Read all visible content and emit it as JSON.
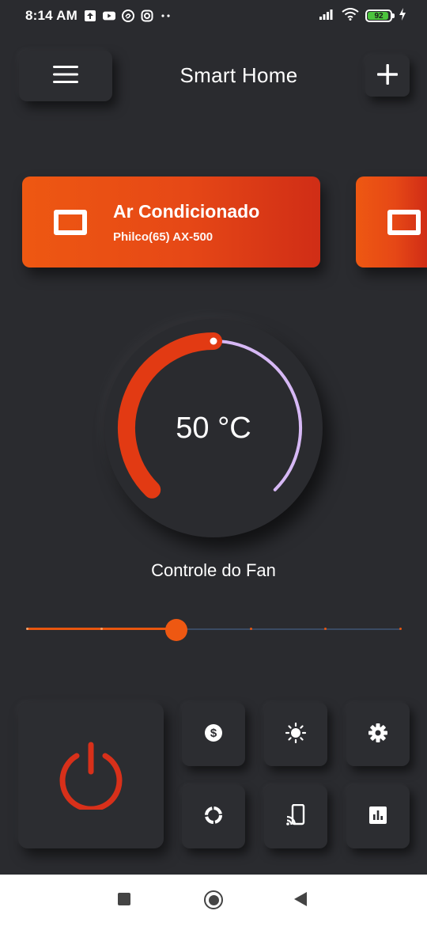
{
  "status_bar": {
    "time": "8:14 AM",
    "icons_left": [
      "upload-icon",
      "youtube-icon",
      "shazam-icon",
      "instagram-icon",
      "more-dots-icon"
    ],
    "icons_right": [
      "signal-icon",
      "wifi-icon"
    ],
    "battery_level": "92",
    "charging": true
  },
  "header": {
    "title": "Smart Home",
    "menu_icon": "hamburger-menu-icon",
    "add_icon": "plus-icon"
  },
  "devices": [
    {
      "name": "Ar Condicionado",
      "model": "Philco(65) AX-500",
      "icon": "device-screen-icon"
    },
    {
      "name": "",
      "model": "",
      "icon": "device-screen-icon"
    }
  ],
  "gauge": {
    "value_label": "50 °C",
    "value": 50,
    "fraction": 0.5,
    "active_color": "#e23a13",
    "rest_color": "#d6b8f5"
  },
  "fan": {
    "label": "Controle do Fan",
    "level": 2,
    "max_level": 5,
    "active_color": "#e8560f",
    "track_color": "#3a4a63"
  },
  "controls": {
    "power_icon": "power-icon",
    "power_color": "#d8301a",
    "tiles": [
      "dollar-icon",
      "brightness-icon",
      "settings-icon",
      "loading-ring-icon",
      "cast-icon",
      "bar-chart-icon"
    ]
  },
  "nav_bar": {
    "buttons": [
      "recent-apps-icon",
      "home-icon",
      "back-icon"
    ]
  }
}
